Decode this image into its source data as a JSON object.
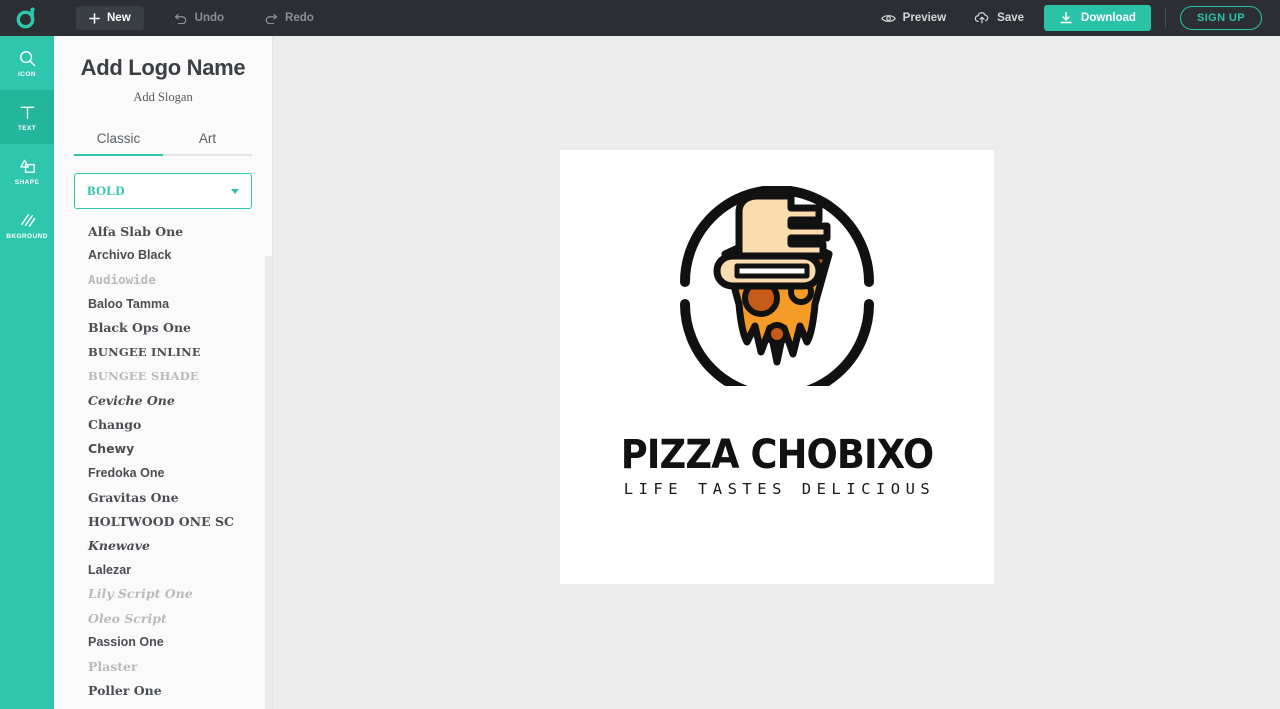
{
  "topbar": {
    "brand_icon": "droplet-logo-icon",
    "new_label": "New",
    "undo_label": "Undo",
    "redo_label": "Redo",
    "preview_label": "Preview",
    "save_label": "Save",
    "download_label": "Download",
    "signup_label": "SIGN UP",
    "accent_color": "#2bc3a8",
    "background_color": "#2b2f33"
  },
  "rail": {
    "accent_color": "#2ec6ac",
    "items": [
      {
        "label": "ICON",
        "icon": "search-icon",
        "active": false
      },
      {
        "label": "TEXT",
        "icon": "text-t-icon",
        "active": true
      },
      {
        "label": "SHAPE",
        "icon": "shape-icon",
        "active": false
      },
      {
        "label": "BKGROUND",
        "icon": "hatch-pattern-icon",
        "active": false
      }
    ]
  },
  "panel": {
    "title": "Add Logo Name",
    "slogan": "Add Slogan",
    "tabs": [
      {
        "label": "Classic",
        "active": true
      },
      {
        "label": "Art",
        "active": false
      }
    ],
    "category_select": {
      "value": "BOLD",
      "icon": "chevron-down-icon"
    },
    "fonts": [
      {
        "name": "Alfa Slab One",
        "style": "f-dvs"
      },
      {
        "name": "Archivo Black",
        "style": "f-sans"
      },
      {
        "name": "Audiowide",
        "style": "f-mono i-light"
      },
      {
        "name": "Baloo Tamma",
        "style": "f-sans"
      },
      {
        "name": "Black Ops One",
        "style": "f-dvs"
      },
      {
        "name": "BUNGEE INLINE",
        "style": "f-dvs i-caps"
      },
      {
        "name": "BUNGEE SHADE",
        "style": "f-dvs i-caps i-light"
      },
      {
        "name": "Ceviche One",
        "style": "f-dvs i-it"
      },
      {
        "name": "Chango",
        "style": "f-dvs"
      },
      {
        "name": "Chewy",
        "style": "f-dv"
      },
      {
        "name": "Fredoka One",
        "style": "f-sans"
      },
      {
        "name": "Gravitas One",
        "style": "f-dvs"
      },
      {
        "name": "HOLTWOOD ONE SC",
        "style": "f-dvs i-sc"
      },
      {
        "name": "Knewave",
        "style": "f-dvs i-it"
      },
      {
        "name": "Lalezar",
        "style": "f-sans"
      },
      {
        "name": "Lily Script One",
        "style": "f-dvs i-it i-light"
      },
      {
        "name": "Oleo Script",
        "style": "f-dvs i-it i-light"
      },
      {
        "name": "Passion One",
        "style": "f-sans"
      },
      {
        "name": "Plaster",
        "style": "f-dvs i-light"
      },
      {
        "name": "Poller One",
        "style": "f-dvs"
      }
    ]
  },
  "canvas": {
    "background_color": "#ffffff",
    "stage_color": "#ececec",
    "logo_name": "PIZZA CHOBIXO",
    "logo_tagline": "LIFE TASTES DELICIOUS",
    "artwork": {
      "icon": "hand-holding-pizza-slice-icon",
      "cheese_color": "#F59C28",
      "crust_color": "#C65A18",
      "skin_color": "#FBDCAE",
      "outline_color": "#111111"
    }
  }
}
